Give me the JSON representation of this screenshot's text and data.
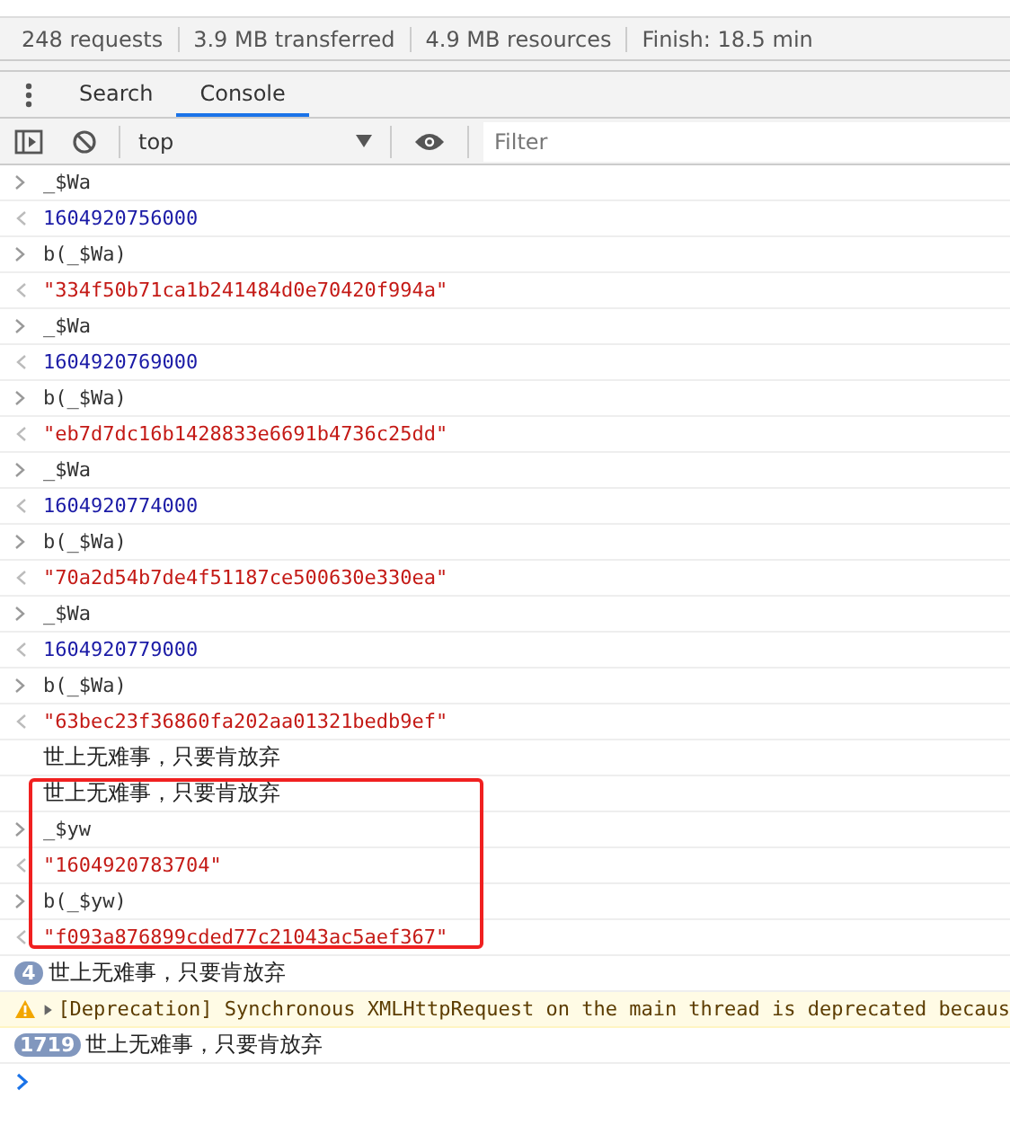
{
  "network_summary": [
    "248 requests",
    "3.9 MB transferred",
    "4.9 MB resources",
    "Finish: 18.5 min"
  ],
  "drawer_tabs": [
    {
      "label": "Search",
      "selected": false
    },
    {
      "label": "Console",
      "selected": true
    }
  ],
  "toolbar": {
    "context": "top",
    "filter": {
      "placeholder": "Filter"
    }
  },
  "console": [
    {
      "kind": "input",
      "text": "_$Wa"
    },
    {
      "kind": "number",
      "text": "1604920756000"
    },
    {
      "kind": "input",
      "text": "b(_$Wa)"
    },
    {
      "kind": "string",
      "text": "\"334f50b71ca1b241484d0e70420f994a\""
    },
    {
      "kind": "input",
      "text": "_$Wa"
    },
    {
      "kind": "number",
      "text": "1604920769000"
    },
    {
      "kind": "input",
      "text": "b(_$Wa)"
    },
    {
      "kind": "string",
      "text": "\"eb7d7dc16b1428833e6691b4736c25dd\""
    },
    {
      "kind": "input",
      "text": "_$Wa"
    },
    {
      "kind": "number",
      "text": "1604920774000"
    },
    {
      "kind": "input",
      "text": "b(_$Wa)"
    },
    {
      "kind": "string",
      "text": "\"70a2d54b7de4f51187ce500630e330ea\""
    },
    {
      "kind": "input",
      "text": "_$Wa"
    },
    {
      "kind": "number",
      "text": "1604920779000"
    },
    {
      "kind": "input",
      "text": "b(_$Wa)"
    },
    {
      "kind": "string",
      "text": "\"63bec23f36860fa202aa01321bedb9ef\""
    },
    {
      "kind": "log",
      "text": "世上无难事，只要肯放弃"
    },
    {
      "kind": "log",
      "text": "世上无难事，只要肯放弃"
    },
    {
      "kind": "input",
      "text": "_$yw"
    },
    {
      "kind": "string",
      "text": "\"1604920783704\""
    },
    {
      "kind": "input",
      "text": "b(_$yw)"
    },
    {
      "kind": "string",
      "text": "\"f093a876899cded77c21043ac5aef367\""
    },
    {
      "kind": "log",
      "count": "4",
      "text": "世上无难事，只要肯放弃"
    },
    {
      "kind": "warning",
      "text": "[Deprecation] Synchronous XMLHttpRequest on the main thread is deprecated becaus"
    },
    {
      "kind": "log",
      "count": "1719",
      "text": "世上无难事，只要肯放弃"
    }
  ]
}
